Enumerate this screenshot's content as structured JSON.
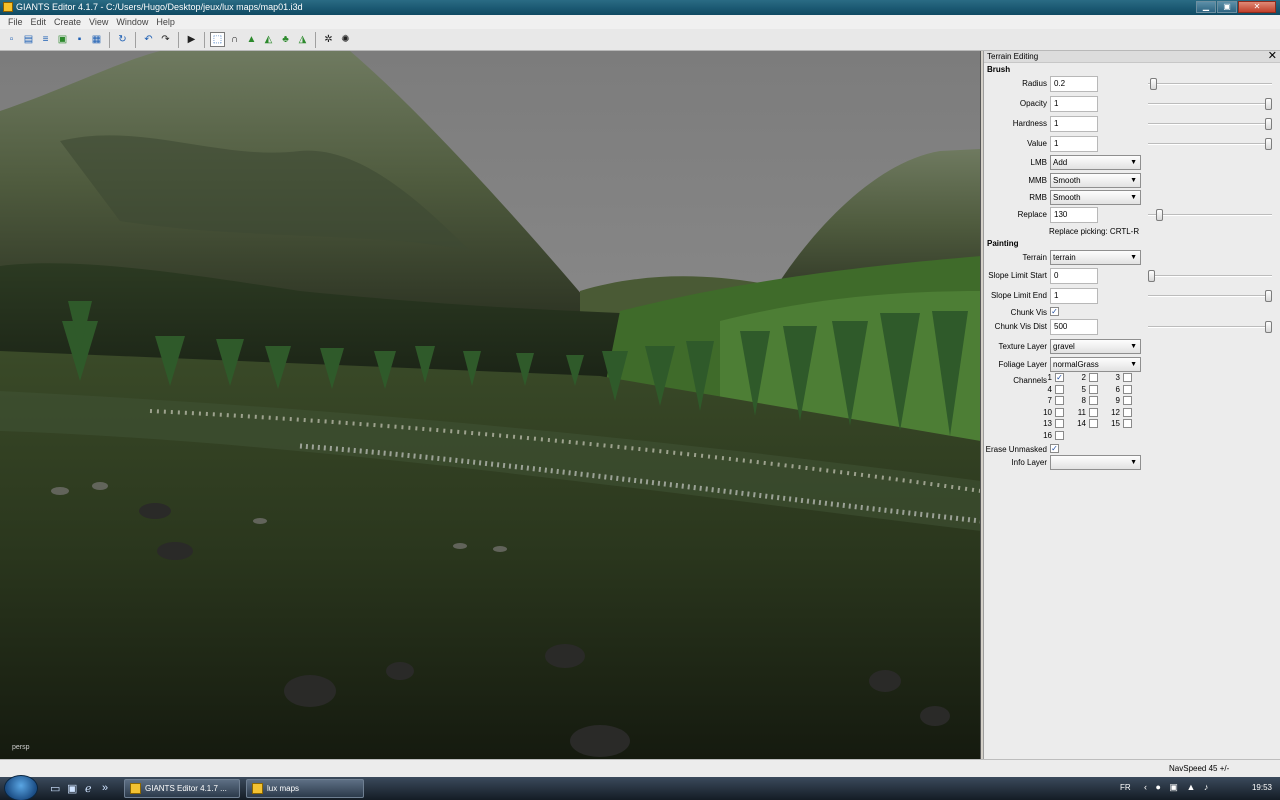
{
  "window": {
    "title": "GIANTS Editor 4.1.7 - C:/Users/Hugo/Desktop/jeux/lux maps/map01.i3d",
    "min": "▁",
    "max": "▣",
    "close": "✕"
  },
  "menu": [
    "File",
    "Edit",
    "Create",
    "View",
    "Window",
    "Help"
  ],
  "toolbar_icons": [
    "new-file-icon",
    "open-file-icon",
    "script-icon",
    "import-icon",
    "save-icon",
    "save-as-icon",
    "refresh-icon",
    "undo-icon",
    "redo-icon",
    "play-icon",
    "select-tool-icon",
    "move-tool-icon",
    "terrain-sculpt-icon",
    "terrain-paint-icon",
    "foliage-paint-icon",
    "terrain-detail-icon",
    "settings-icon",
    "settings-alt-icon"
  ],
  "viewport": {
    "camera_label": "persp"
  },
  "panel": {
    "title": "Terrain Editing",
    "close": "✕",
    "brush_heading": "Brush",
    "radius": {
      "label": "Radius",
      "value": "0.2",
      "level": 0.02
    },
    "opacity": {
      "label": "Opacity",
      "value": "1",
      "level": 1.0
    },
    "hardness": {
      "label": "Hardness",
      "value": "1",
      "level": 1.0
    },
    "value": {
      "label": "Value",
      "value": "1",
      "level": 1.0
    },
    "lmb": {
      "label": "LMB",
      "value": "Add"
    },
    "mmb": {
      "label": "MMB",
      "value": "Smooth"
    },
    "rmb": {
      "label": "RMB",
      "value": "Smooth"
    },
    "replace": {
      "label": "Replace",
      "value": "130",
      "level": 0.07
    },
    "replace_hint": "Replace picking: CRTL-R",
    "painting_heading": "Painting",
    "terrain": {
      "label": "Terrain",
      "value": "terrain"
    },
    "slope_start": {
      "label": "Slope Limit Start",
      "value": "0",
      "level": 0.0
    },
    "slope_end": {
      "label": "Slope Limit End",
      "value": "1",
      "level": 1.0
    },
    "chunk_vis": {
      "label": "Chunk Vis",
      "checked": true
    },
    "chunk_vis_dist": {
      "label": "Chunk Vis Dist",
      "value": "500",
      "level": 1.0
    },
    "texture_layer": {
      "label": "Texture Layer",
      "value": "gravel"
    },
    "foliage_layer": {
      "label": "Foliage Layer",
      "value": "normalGrass"
    },
    "channels": {
      "label": "Channels",
      "items": [
        {
          "n": "1",
          "checked": true
        },
        {
          "n": "2",
          "checked": false
        },
        {
          "n": "3",
          "checked": false
        },
        {
          "n": "4",
          "checked": false
        },
        {
          "n": "5",
          "checked": false
        },
        {
          "n": "6",
          "checked": false
        },
        {
          "n": "7",
          "checked": false
        },
        {
          "n": "8",
          "checked": false
        },
        {
          "n": "9",
          "checked": false
        },
        {
          "n": "10",
          "checked": false
        },
        {
          "n": "11",
          "checked": false
        },
        {
          "n": "12",
          "checked": false
        },
        {
          "n": "13",
          "checked": false
        },
        {
          "n": "14",
          "checked": false
        },
        {
          "n": "15",
          "checked": false
        },
        {
          "n": "16",
          "checked": false
        }
      ]
    },
    "erase_unmasked": {
      "label": "Erase Unmasked",
      "checked": true
    },
    "info_layer": {
      "label": "Info Layer",
      "value": ""
    }
  },
  "status": {
    "nav_speed": "NavSpeed 45 +/-"
  },
  "taskbar": {
    "tasks": [
      {
        "label": "GIANTS Editor 4.1.7 ..."
      },
      {
        "label": "lux maps"
      }
    ],
    "language": "FR",
    "clock": "19:53"
  }
}
